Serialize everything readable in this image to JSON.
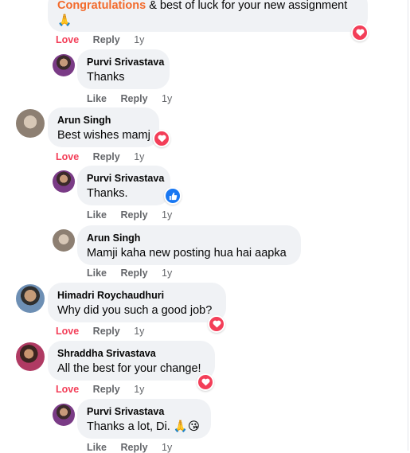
{
  "comments": [
    {
      "highlight": "Congratulations",
      "text": "& best of luck for your new assignment",
      "emoji": "🙏",
      "actions": {
        "love": "Love",
        "reply": "Reply",
        "time": "1y"
      }
    },
    {
      "author": "Purvi Srivastava",
      "text": "Thanks",
      "actions": {
        "like": "Like",
        "reply": "Reply",
        "time": "1y"
      }
    },
    {
      "author": "Arun Singh",
      "text": "Best wishes mamj",
      "actions": {
        "love": "Love",
        "reply": "Reply",
        "time": "1y"
      }
    },
    {
      "author": "Purvi Srivastava",
      "text": "Thanks.",
      "actions": {
        "like": "Like",
        "reply": "Reply",
        "time": "1y"
      }
    },
    {
      "author": "Arun Singh",
      "text": "Mamji kaha new posting hua hai aapka",
      "actions": {
        "like": "Like",
        "reply": "Reply",
        "time": "1y"
      }
    },
    {
      "author": "Himadri Roychaudhuri",
      "text": "Why did you such a good job?",
      "actions": {
        "love": "Love",
        "reply": "Reply",
        "time": "1y"
      }
    },
    {
      "author": "Shraddha Srivastava",
      "text": "All the best for your change!",
      "actions": {
        "love": "Love",
        "reply": "Reply",
        "time": "1y"
      }
    },
    {
      "author": "Purvi Srivastava",
      "text": "Thanks a lot, Di.",
      "emoji": "🙏😘",
      "actions": {
        "like": "Like",
        "reply": "Reply",
        "time": "1y"
      }
    }
  ],
  "colors": {
    "love": "#f33e58",
    "like": "#1877f2",
    "bubble": "#f0f2f5",
    "meta": "#65676b"
  }
}
